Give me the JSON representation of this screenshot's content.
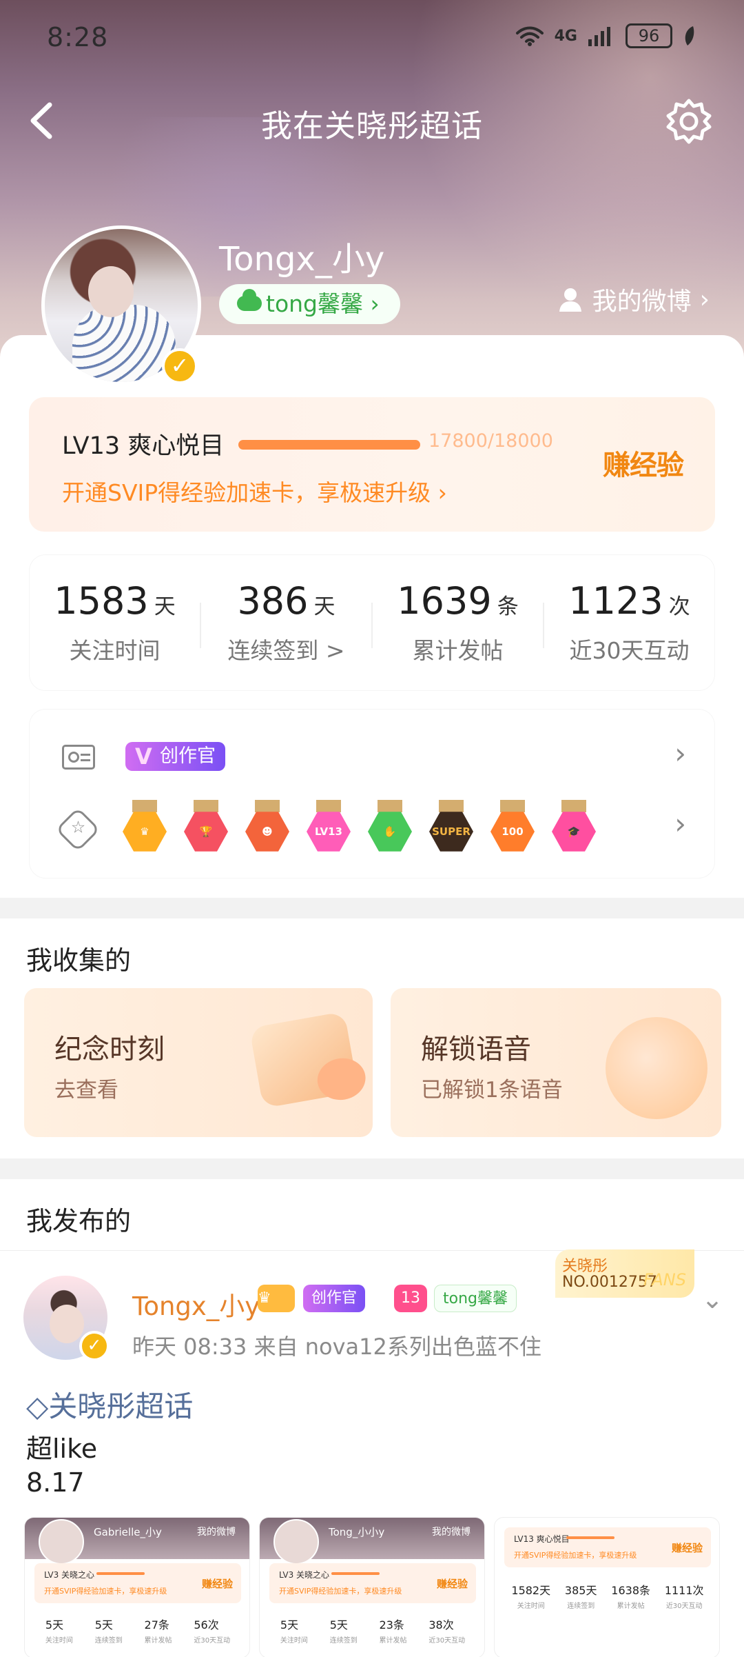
{
  "status_bar": {
    "time": "8:28",
    "network": "4G",
    "battery": "96"
  },
  "header": {
    "title": "我在关晓彤超话"
  },
  "profile": {
    "username": "Tongx_小y",
    "fan_tag": "tong馨馨",
    "weibo_link": "我的微博"
  },
  "level": {
    "name": "LV13 爽心悦目",
    "value": "17800/18000",
    "progress": 0.989,
    "promo": "开通SVIP得经验加速卡，享极速升级",
    "exp_button": "赚经验"
  },
  "stats": [
    {
      "value": "1583",
      "unit": "天",
      "label": "关注时间"
    },
    {
      "value": "386",
      "unit": "天",
      "label": "连续签到 >"
    },
    {
      "value": "1639",
      "unit": "条",
      "label": "累计发帖"
    },
    {
      "value": "1123",
      "unit": "次",
      "label": "近30天互动"
    }
  ],
  "badges": {
    "creator": "创作官",
    "items": [
      "crown",
      "trophy",
      "cartoon",
      "LV13",
      "hand",
      "SUPER",
      "100 DAYS",
      "cap"
    ]
  },
  "collections": {
    "title": "我收集的",
    "items": [
      {
        "title": "纪念时刻",
        "subtitle": "去查看"
      },
      {
        "title": "解锁语音",
        "subtitle": "已解锁1条语音"
      }
    ]
  },
  "posts_section": {
    "title": "我发布的"
  },
  "post": {
    "author": "Tongx_小y",
    "creator_badge": "创作官",
    "level_badge": "13",
    "fan_tag": "tong馨馨",
    "fans_label": "关晓彤",
    "fans_number": "NO.0012757",
    "fans_word": "FANS",
    "meta": "昨天 08:33  来自 nova12系列出色蓝不住",
    "topic": "关晓彤超话",
    "line1": "超like",
    "line2": "8.17",
    "thumbnails": [
      {
        "name": "Gabrielle_小y",
        "link": "我的微博",
        "level": "LV3 关晓之心",
        "promo": "开通SVIP得经验加速卡，享极速升级",
        "exp": "赚经验",
        "stats": [
          [
            "5",
            "天",
            "关注时间"
          ],
          [
            "5",
            "天",
            "连续签到"
          ],
          [
            "27",
            "条",
            "累计发帖"
          ],
          [
            "56",
            "次",
            "近30天互动"
          ]
        ]
      },
      {
        "name": "Tong_小小y",
        "link": "我的微博",
        "level": "LV3 关晓之心",
        "promo": "开通SVIP得经验加速卡，享极速升级",
        "exp": "赚经验",
        "stats": [
          [
            "5",
            "天",
            "关注时间"
          ],
          [
            "5",
            "天",
            "连续签到"
          ],
          [
            "23",
            "条",
            "累计发帖"
          ],
          [
            "38",
            "次",
            "近30天互动"
          ]
        ]
      },
      {
        "name": "",
        "link": "",
        "level": "LV13 爽心悦目",
        "promo": "开通SVIP得经验加速卡，享极速升级",
        "exp": "赚经验",
        "stats": [
          [
            "1582",
            "天",
            "关注时间"
          ],
          [
            "385",
            "天",
            "连续签到"
          ],
          [
            "1638",
            "条",
            "累计发帖"
          ],
          [
            "1111",
            "次",
            "近30天互动"
          ]
        ]
      }
    ]
  }
}
